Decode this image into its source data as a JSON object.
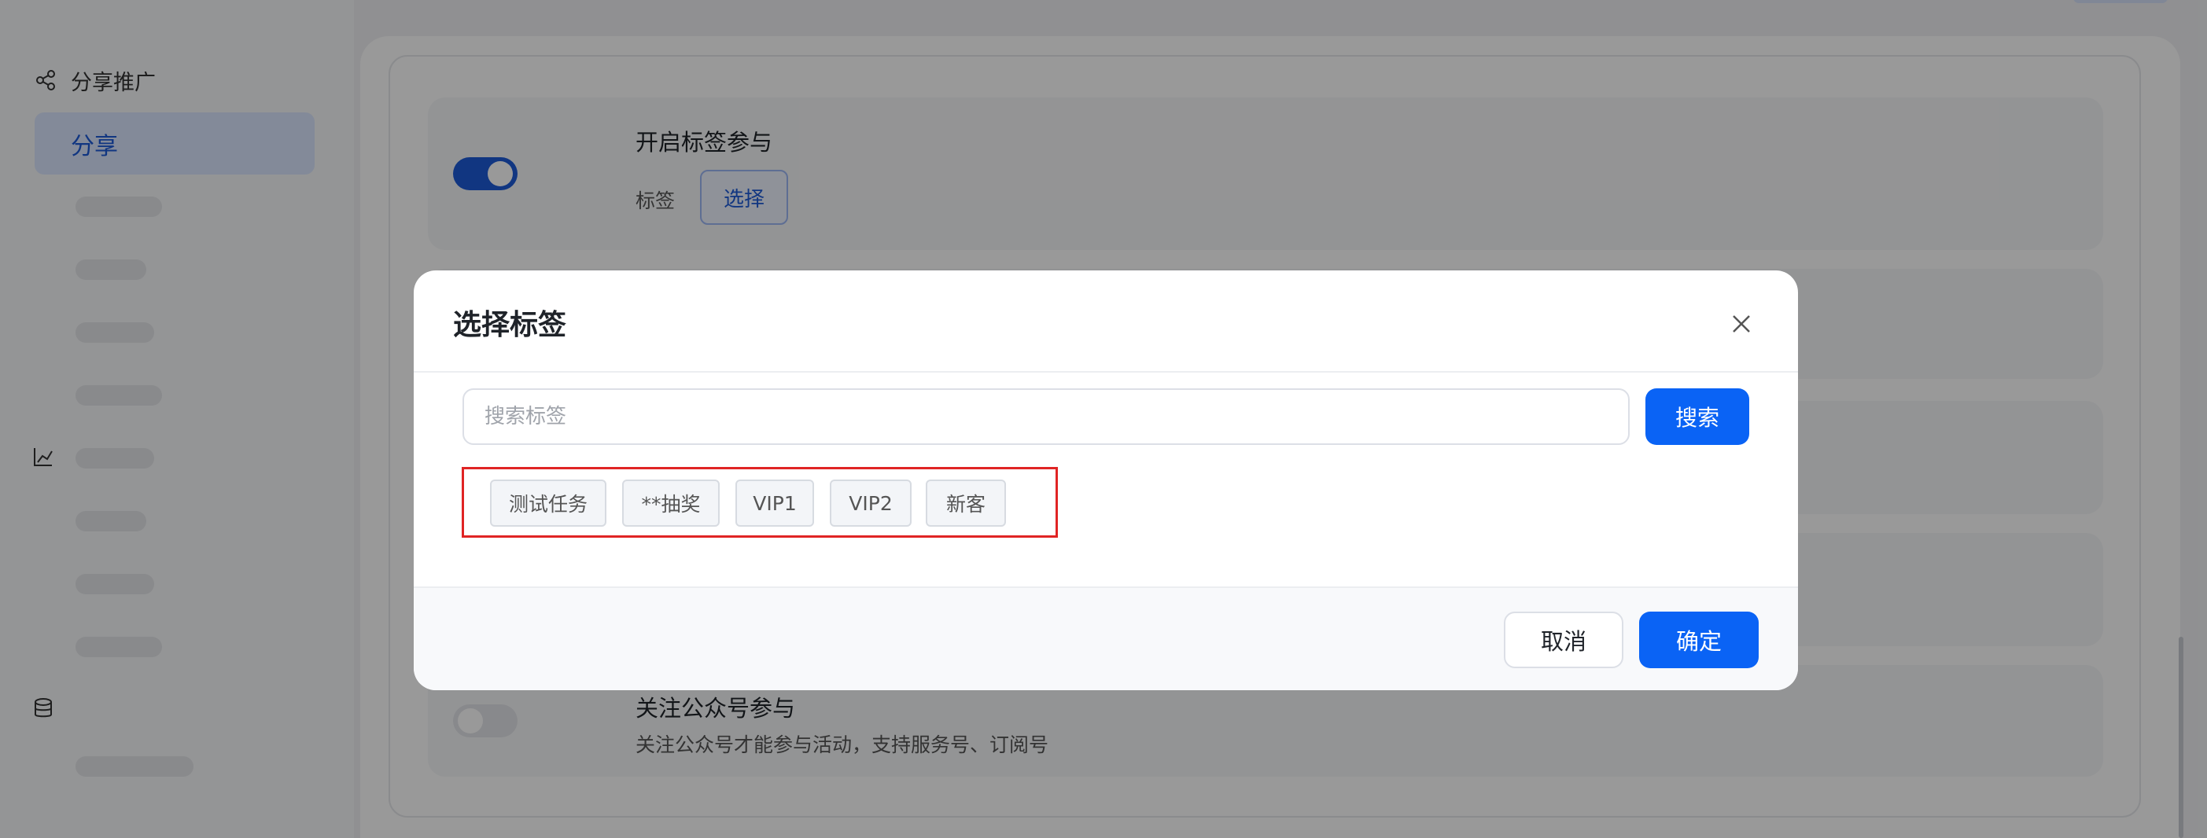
{
  "sidebar": {
    "group_label": "分享推广",
    "active_item": "分享"
  },
  "settings": {
    "tag_row": {
      "title": "开启标签参与",
      "tag_label": "标签",
      "select_label": "选择",
      "enabled": true
    },
    "follow_row": {
      "title": "关注公众号参与",
      "description": "关注公众号才能参与活动，支持服务号、订阅号",
      "enabled": false
    }
  },
  "modal": {
    "title": "选择标签",
    "search": {
      "placeholder": "搜索标签",
      "value": "",
      "button": "搜索"
    },
    "tags": [
      "测试任务",
      "**抽奖",
      "VIP1",
      "VIP2",
      "新客"
    ],
    "cancel_label": "取消",
    "confirm_label": "确定"
  },
  "colors": {
    "primary": "#0a63f5",
    "highlight_border": "#e02424",
    "overlay": "rgba(0,0,0,0.40)"
  },
  "icons": {
    "share": "share-icon",
    "close": "close-icon"
  }
}
